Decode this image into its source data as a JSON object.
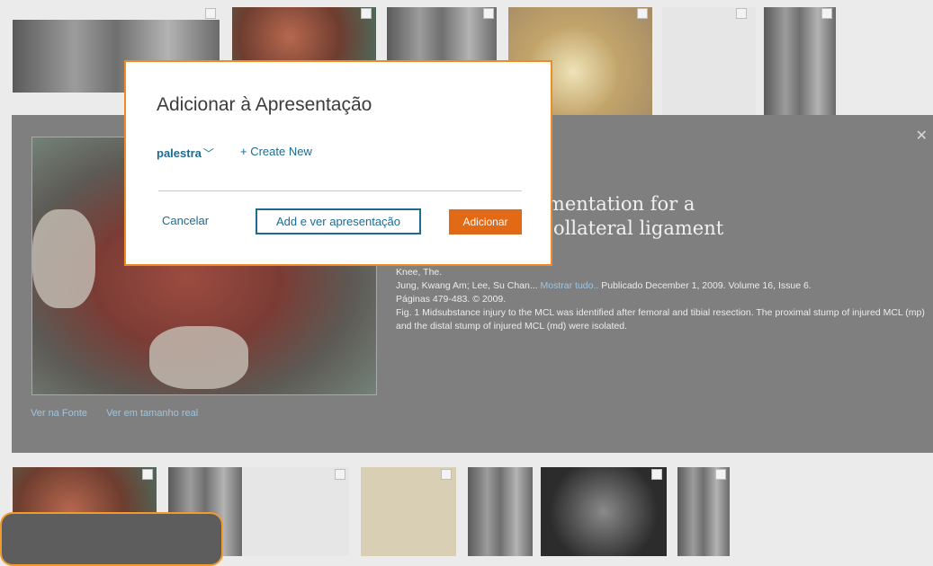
{
  "modal": {
    "title": "Adicionar à Apresentação",
    "presentation_selected": "palestra",
    "create_new": "+ Create New",
    "cancel": "Cancelar",
    "add_and_view": "Add e ver apresentação",
    "add": "Adicionar"
  },
  "detail": {
    "title_visible": "n free graft augmentation for a\nr of the medial collateral ligament\narthroplasty",
    "journal": "Knee, The.",
    "authors": "Jung, Kwang Am; Lee, Su Chan...",
    "show_all": "Mostrar tudo..",
    "published": "Publicado December 1, 2009. Volume 16, Issue 6.",
    "pages": "Páginas 479-483. © 2009.",
    "caption": "Fig. 1 Midsubstance injury to the MCL was identified after femoral and tibial resection. The proximal stump of injured MCL (mp) and the distal stump of injured MCL (md) were isolated.",
    "view_source": "Ver na Fonte",
    "view_full_size": "Ver em tamanho real",
    "close_icon": "close-icon"
  },
  "colors": {
    "accent_orange": "#e26a17",
    "modal_border": "#f08a24",
    "link_blue": "#1b6b93"
  }
}
